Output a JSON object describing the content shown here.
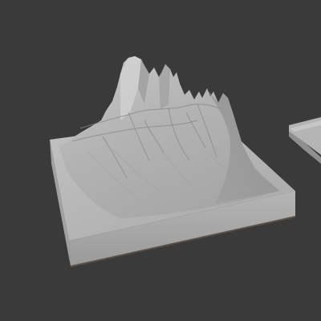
{
  "viewport": {
    "background_color": "#3a3a3a"
  },
  "scene": {
    "objects": [
      {
        "name": "terrain-block",
        "description_icon": "mesh-object"
      },
      {
        "name": "terrain-block-secondary",
        "description_icon": "mesh-object"
      }
    ],
    "colors": {
      "mesh_top": "#b8b8b8",
      "mesh_side_light": "#a9a9a9",
      "mesh_side_dark": "#8c8c8c",
      "mesh_shadow": "#6e6e6e",
      "base_edge": "#5a5048"
    }
  }
}
